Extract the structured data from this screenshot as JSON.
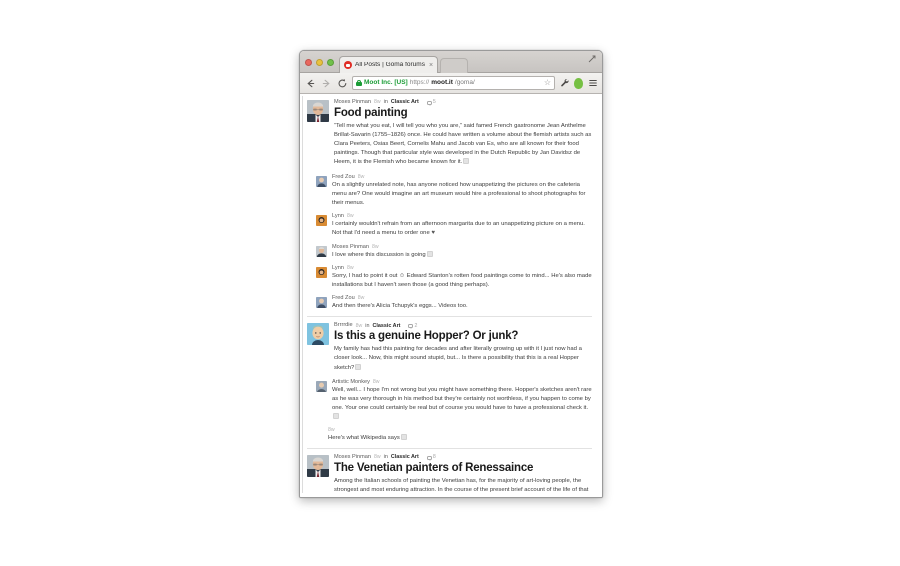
{
  "browser": {
    "traffic_lights": [
      "close",
      "minimize",
      "zoom"
    ],
    "tab": {
      "title": "All Posts | Goma forums",
      "favicon": "goma-logo-icon",
      "close_label": "×"
    },
    "maximize_label": "maximize-window",
    "toolbar": {
      "back_label": "←",
      "forward_label": "→",
      "reload_label": "C",
      "security_site_name": "Moot Inc. [US]",
      "url_scheme": "https://",
      "url_host": "moot.it",
      "url_path": "/goma/",
      "star_label": "☆",
      "extension_icon": "wrench-icon",
      "profile_icon": "profile-avatar-icon",
      "menu_icon": "hamburger-menu-icon"
    }
  },
  "feed": {
    "posts": [
      {
        "author": "Moses Pinman",
        "timestamp": "8w",
        "in_word": "in",
        "category": "Classic Art",
        "comment_count": "5",
        "title": "Food painting",
        "body": "“Tell me what you eat, I will tell you who you are,” said famed French gastronome Jean Anthelme Brillat-Savarin (1755–1826) once. He could have written a volume about the flemish artists such as Clara Peeters, Osias Beert, Cornelis Mahu and Jacob van Es, who are all known for their food paintings. Though that particular style was developed in the Dutch Republic by Jan Davidsz de Heem, it is the Flemish who became known for it.",
        "body_has_trailing_box": true,
        "comments": [
          {
            "author": "Fred Zou",
            "timestamp": "8w",
            "text": "On a slightly unrelated note, has anyone noticed how unappetizing the pictures on the cafeteria menu are? One would imagine an art museum would hire a professional to shoot photographs for their menus.",
            "avatar": "avatar-fred-zou"
          },
          {
            "author": "Lynn",
            "timestamp": "8w",
            "text": "I certainly wouldn't refrain from an afternoon margarita due to an unappetizing picture on a menu. Not that I'd need a menu to order one",
            "trailing_glyph": "♥",
            "avatar": "avatar-lynn"
          },
          {
            "author": "Moses Pinman",
            "timestamp": "8w",
            "text": "I love where this discussion is going",
            "trailing_box": true,
            "avatar": "avatar-moses-pinman"
          },
          {
            "author": "Lynn",
            "timestamp": "8w",
            "text": "Sorry, I had to point it out ☺ Edward Stanton's rotten food paintings come to mind... He's also made installations but I haven't seen those (a good thing perhaps).",
            "avatar": "avatar-lynn"
          },
          {
            "author": "Fred Zou",
            "timestamp": "8w",
            "text": "And then there's Alicia Tchupyk's eggs... Videos too.",
            "avatar": "avatar-fred-zou"
          }
        ]
      },
      {
        "author": "Brrrrdie",
        "timestamp": "8w",
        "in_word": "in",
        "category": "Classic Art",
        "comment_count": "2",
        "title": "Is this a genuine Hopper? Or junk?",
        "body": "My family has had this painting for decades and after literally growing up with it I just now had a closer look... Now, this might sound stupid, but... Is there a possibility that this is a real Hopper sketch?",
        "body_has_trailing_box": true,
        "comments": [
          {
            "author": "Artistic Monkey",
            "timestamp": "8w",
            "text": "Well, well... I hope I'm not wrong but you might have something there. Hopper's sketches aren't rare as he was very thorough in his method but they're certainly not worthless, if you happen to come by one. Your one could certainly be real but of course you would have to have a professional check it.",
            "trailing_box": true,
            "avatar": "avatar-artistic-monkey"
          },
          {
            "author": "",
            "timestamp": "8w",
            "text": "Here's what Wikipedia says",
            "trailing_box": true,
            "avatar": "none",
            "nested": true
          }
        ]
      },
      {
        "author": "Moses Pinman",
        "timestamp": "8w",
        "in_word": "in",
        "category": "Classic Art",
        "comment_count": "8",
        "title": "The Venetian painters of Renessaince",
        "body": "Among the Italian schools of painting the Venetian has, for the majority of art-loving people, the strongest and most enduring attraction. In the course of the present brief account of the life of that school we shall perhaps discover some of the causes of our peculiar delight and interest in the Venetian painters, as we come to realise what tendencies of the human spirit their art embodied, and of what great consequence their example has been to the whole of European painting for the last three centuries.",
        "body_has_trailing_box": false,
        "comments": []
      }
    ]
  },
  "colors": {
    "accent_green": "#1a9c35",
    "profile_green": "#76c043",
    "favicon_red": "#e02d25",
    "text_dark": "#1a1a1a",
    "text_body": "#3b3b3b",
    "meta_grey": "#b3b3b3"
  }
}
